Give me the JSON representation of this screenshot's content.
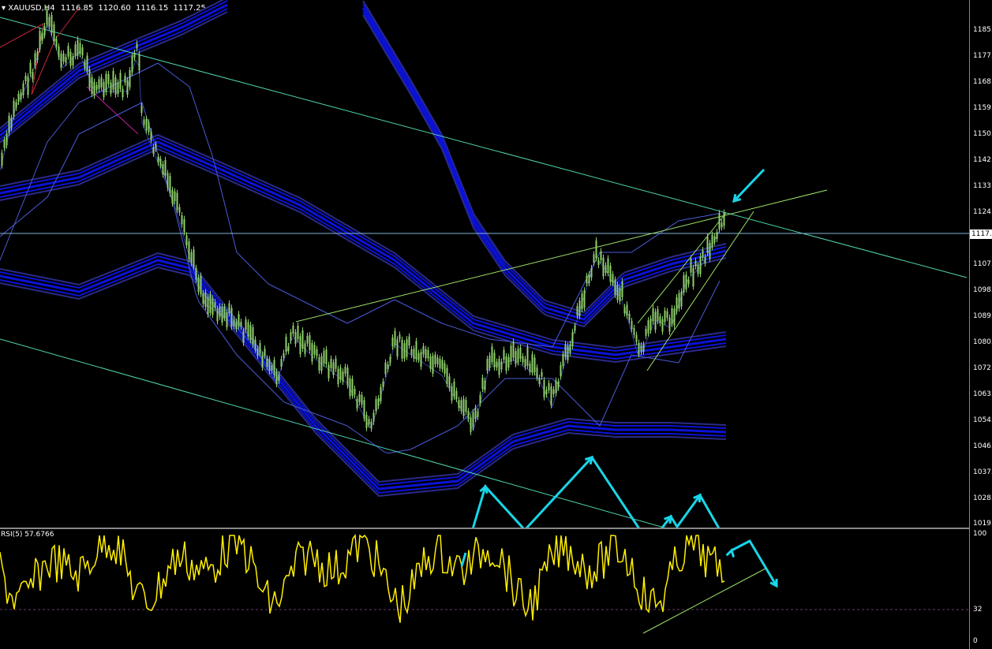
{
  "header": {
    "symbol": "XAUUSD,H4",
    "open": "1116.85",
    "high": "1120.60",
    "low": "1116.15",
    "close": "1117.25"
  },
  "price_axis": {
    "labels": [
      "1185.",
      "1177.",
      "1168.",
      "1159.",
      "1150.",
      "1142.",
      "1133.",
      "1124.",
      "1107.",
      "1098.",
      "1089.",
      "1080.",
      "1072.",
      "1063.",
      "1054.",
      "1046.",
      "1037.",
      "1028.",
      "1019."
    ],
    "current_price": "1117."
  },
  "rsi": {
    "label": "RSI(5) 57.6766",
    "levels": [
      "100",
      "32",
      "0"
    ]
  },
  "colors": {
    "background": "#000000",
    "candle": "#8fd16b",
    "envelope": "#0b12d8",
    "bollinger": "#4a5ad6",
    "channel": "#4fd3b0",
    "trend": "#9be36a",
    "arrow": "#18d6e8",
    "rsi_line": "#ffee00",
    "zigzag": "#c0283a"
  },
  "chart_data": [
    {
      "type": "candlestick",
      "title": "XAUUSD,H4",
      "ylim": [
        1019,
        1190
      ],
      "last_close": 1117.25,
      "overlays": [
        "bollinger-bands",
        "moving-average-envelopes",
        "regression-channel",
        "trendlines"
      ]
    },
    {
      "type": "line",
      "title": "RSI(5) 57.6766",
      "ylim": [
        0,
        100
      ],
      "levels": [
        32
      ]
    }
  ]
}
